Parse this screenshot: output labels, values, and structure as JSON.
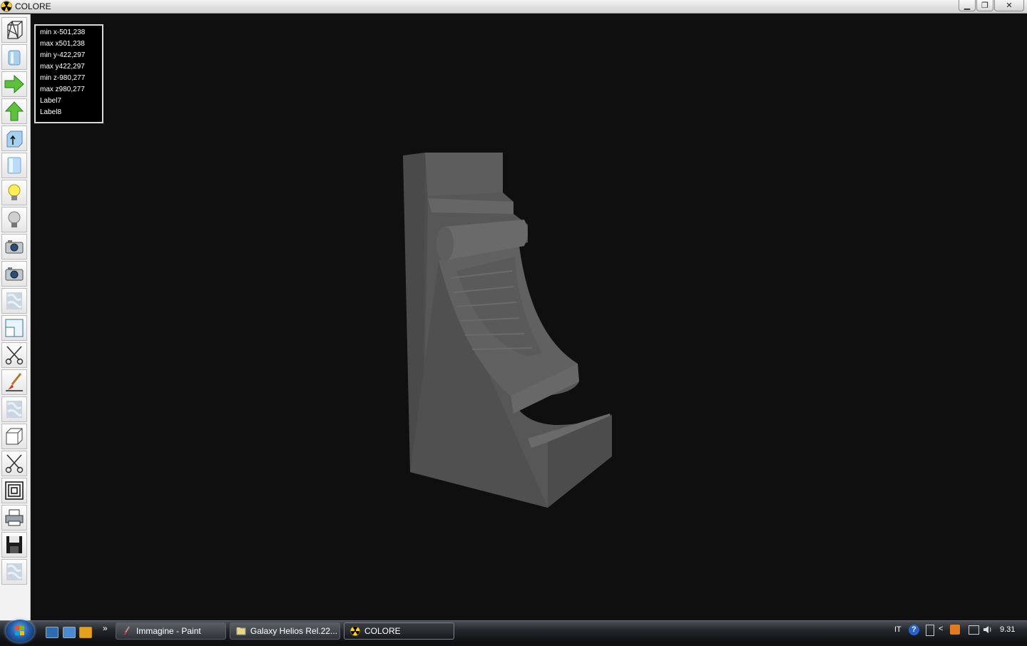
{
  "window": {
    "title": "COLORE",
    "icon": "radiation-icon",
    "buttons": {
      "minimize": "▁",
      "restore": "❐",
      "close": "✕"
    }
  },
  "toolbar": {
    "tools": [
      "wireframe-icon",
      "solid-view-icon",
      "arrow-right-icon",
      "arrow-up-icon",
      "extrude-icon",
      "cylinder-icon",
      "light-on-icon",
      "light-off-icon",
      "camera-icon",
      "camera-2-icon",
      "texture-icon",
      "viewport-icon",
      "scissors-icon",
      "brush-icon",
      "texture-2-icon",
      "cube-icon",
      "scissors-2-icon",
      "frame-icon",
      "printer-icon",
      "floppy-disk-icon",
      "texture-3-icon"
    ]
  },
  "info": {
    "lines": [
      "min x-501,238",
      "max x501,238",
      "min y-422,297",
      "max y422,297",
      "min z-980,277",
      "max z980,277",
      "Label7",
      "Label8"
    ]
  },
  "taskbar": {
    "quicklaunch_more": "»",
    "tasks": [
      {
        "label": "Immagine - Paint",
        "icon": "paint-icon"
      },
      {
        "label": "Galaxy Helios  Rel.22...",
        "icon": "folder-icon"
      },
      {
        "label": "COLORE",
        "icon": "radiation-icon"
      }
    ],
    "tray": {
      "language": "IT",
      "clock": "9.31",
      "chevron": "<"
    }
  },
  "colors": {
    "viewport_bg": "#0f0f0f",
    "model": "#555555",
    "accent": "#ffd400"
  }
}
